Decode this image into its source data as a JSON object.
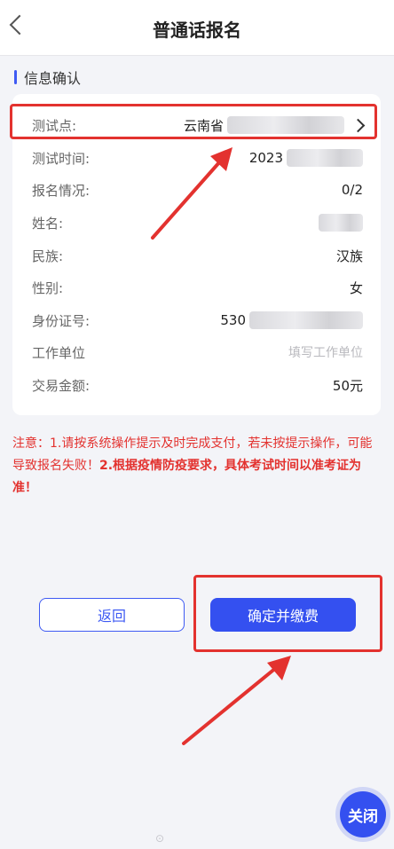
{
  "header": {
    "title": "普通话报名"
  },
  "section": {
    "title": "信息确认"
  },
  "rows": [
    {
      "label": "测试点:",
      "value": "云南省"
    },
    {
      "label": "测试时间:",
      "value": "2023"
    },
    {
      "label": "报名情况:",
      "value": "0/2"
    },
    {
      "label": "姓名:",
      "value": ""
    },
    {
      "label": "民族:",
      "value": "汉族"
    },
    {
      "label": "性别:",
      "value": "女"
    },
    {
      "label": "身份证号:",
      "value": "530"
    },
    {
      "label": "工作单位",
      "placeholder": "填写工作单位"
    },
    {
      "label": "交易金额:",
      "value": "50元"
    }
  ],
  "note": {
    "prefix": "注意：",
    "text": "1.请按系统操作提示及时完成支付，若未按提示操作，可能导致报名失败！",
    "emphasis": "2.根据疫情防疫要求，具体考试时间以准考证为准！"
  },
  "buttons": {
    "back": "返回",
    "confirm": "确定并缴费",
    "close": "关闭"
  },
  "colors": {
    "accent": "#3450f0",
    "annotation": "#e3322f"
  }
}
